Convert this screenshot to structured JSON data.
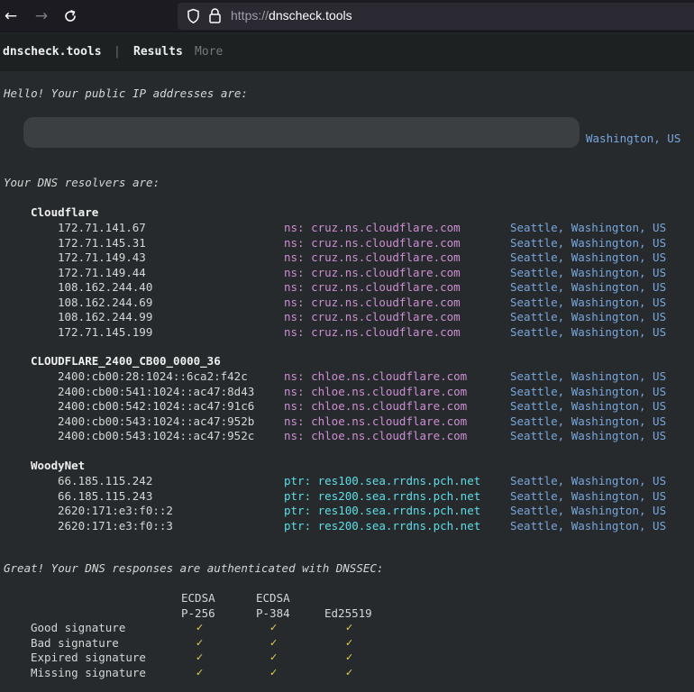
{
  "browser": {
    "url_prefix": "https://",
    "url_domain": "dnscheck.tools"
  },
  "site": {
    "brand": "dnscheck.tools",
    "separator": "|",
    "nav_results": "Results",
    "nav_more": "More"
  },
  "public_ip": {
    "intro": "Hello! Your public IP addresses are:",
    "location": "Washington, US"
  },
  "resolvers_intro": "Your DNS resolvers are:",
  "groups": [
    {
      "name": "Cloudflare",
      "rows": [
        {
          "ip": "172.71.141.67",
          "ns": "ns: cruz.ns.cloudflare.com",
          "loc": "Seattle, Washington, US"
        },
        {
          "ip": "172.71.145.31",
          "ns": "ns: cruz.ns.cloudflare.com",
          "loc": "Seattle, Washington, US"
        },
        {
          "ip": "172.71.149.43",
          "ns": "ns: cruz.ns.cloudflare.com",
          "loc": "Seattle, Washington, US"
        },
        {
          "ip": "172.71.149.44",
          "ns": "ns: cruz.ns.cloudflare.com",
          "loc": "Seattle, Washington, US"
        },
        {
          "ip": "108.162.244.40",
          "ns": "ns: cruz.ns.cloudflare.com",
          "loc": "Seattle, Washington, US"
        },
        {
          "ip": "108.162.244.69",
          "ns": "ns: cruz.ns.cloudflare.com",
          "loc": "Seattle, Washington, US"
        },
        {
          "ip": "108.162.244.99",
          "ns": "ns: cruz.ns.cloudflare.com",
          "loc": "Seattle, Washington, US"
        },
        {
          "ip": "172.71.145.199",
          "ns": "ns: cruz.ns.cloudflare.com",
          "loc": "Seattle, Washington, US"
        }
      ]
    },
    {
      "name": "CLOUDFLARE_2400_CB00_0000_36",
      "rows": [
        {
          "ip": "2400:cb00:28:1024::6ca2:f42c",
          "ns": "ns: chloe.ns.cloudflare.com",
          "loc": "Seattle, Washington, US"
        },
        {
          "ip": "2400:cb00:541:1024::ac47:8d43",
          "ns": "ns: chloe.ns.cloudflare.com",
          "loc": "Seattle, Washington, US"
        },
        {
          "ip": "2400:cb00:542:1024::ac47:91c6",
          "ns": "ns: chloe.ns.cloudflare.com",
          "loc": "Seattle, Washington, US"
        },
        {
          "ip": "2400:cb00:543:1024::ac47:952b",
          "ns": "ns: chloe.ns.cloudflare.com",
          "loc": "Seattle, Washington, US"
        },
        {
          "ip": "2400:cb00:543:1024::ac47:952c",
          "ns": "ns: chloe.ns.cloudflare.com",
          "loc": "Seattle, Washington, US"
        }
      ]
    },
    {
      "name": "WoodyNet",
      "rows": [
        {
          "ip": "66.185.115.242",
          "ns": "ptr: res100.sea.rrdns.pch.net",
          "loc": "Seattle, Washington, US"
        },
        {
          "ip": "66.185.115.243",
          "ns": "ptr: res200.sea.rrdns.pch.net",
          "loc": "Seattle, Washington, US"
        },
        {
          "ip": "2620:171:e3:f0::2",
          "ns": "ptr: res100.sea.rrdns.pch.net",
          "loc": "Seattle, Washington, US"
        },
        {
          "ip": "2620:171:e3:f0::3",
          "ns": "ptr: res200.sea.rrdns.pch.net",
          "loc": "Seattle, Washington, US"
        }
      ]
    }
  ],
  "dnssec": {
    "intro": "Great! Your DNS responses are authenticated with DNSSEC:",
    "columns": [
      {
        "line1": "ECDSA",
        "line2": "P-256"
      },
      {
        "line1": "ECDSA",
        "line2": "P-384"
      },
      {
        "line1": "",
        "line2": "Ed25519"
      }
    ],
    "rows": [
      {
        "label": "Good signature",
        "marks": [
          "✓",
          "✓",
          "✓"
        ]
      },
      {
        "label": "Bad signature",
        "marks": [
          "✓",
          "✓",
          "✓"
        ]
      },
      {
        "label": "Expired signature",
        "marks": [
          "✓",
          "✓",
          "✓"
        ]
      },
      {
        "label": "Missing signature",
        "marks": [
          "✓",
          "✓",
          "✓"
        ]
      }
    ]
  },
  "colors": {
    "background": "#262a2c",
    "nameserver_cloudflare": "#cc8fd2",
    "nameserver_ptr": "#5fdee8",
    "location": "#79a6dc",
    "checkmark": "#e5d34f"
  }
}
